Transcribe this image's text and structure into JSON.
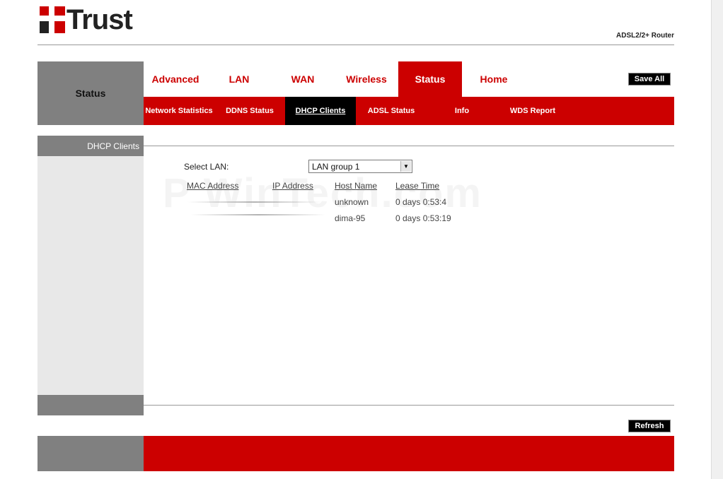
{
  "brand": {
    "logo_text": "Trust",
    "product": "ADSL2/2+ Router"
  },
  "section": {
    "title": "Status"
  },
  "main_tabs": [
    {
      "label": "Advanced",
      "active": false
    },
    {
      "label": "LAN",
      "active": false
    },
    {
      "label": "WAN",
      "active": false
    },
    {
      "label": "Wireless",
      "active": false
    },
    {
      "label": "Status",
      "active": true
    },
    {
      "label": "Home",
      "active": false
    }
  ],
  "sub_tabs": [
    {
      "label": "Network Statistics",
      "active": false
    },
    {
      "label": "DDNS Status",
      "active": false
    },
    {
      "label": "DHCP Clients",
      "active": true
    },
    {
      "label": "ADSL Status",
      "active": false
    },
    {
      "label": "Info",
      "active": false
    },
    {
      "label": "WDS Report",
      "active": false
    }
  ],
  "buttons": {
    "save_all": "Save All",
    "refresh": "Refresh"
  },
  "sidebar": {
    "heading": "DHCP Clients"
  },
  "form": {
    "select_label": "Select LAN:",
    "selected_lan": "LAN group 1"
  },
  "table": {
    "headers": [
      "MAC Address",
      "IP Address",
      "Host Name",
      "Lease Time"
    ],
    "rows": [
      {
        "host": "unknown",
        "lease": "0 days 0:53:4"
      },
      {
        "host": "dima-95",
        "lease": "0 days 0:53:19"
      }
    ]
  },
  "watermark": "P  WinTech.com",
  "colors": {
    "brand_red": "#cc0000",
    "sidebar_grey": "#808080",
    "sidebar_light": "#e8e8e8"
  },
  "icons": {
    "logo": "trust-logo-icon",
    "dropdown": "chevron-down-icon"
  }
}
